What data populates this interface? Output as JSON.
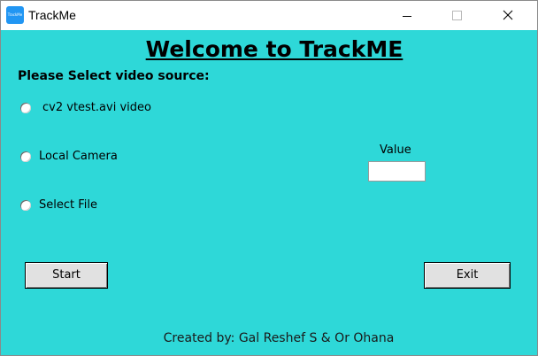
{
  "window": {
    "title": "TrackMe",
    "icon_text": "TrackMe"
  },
  "main": {
    "heading": "Welcome to TrackME",
    "prompt": "Please Select video source:",
    "sources": [
      {
        "label": "cv2 vtest.avi video",
        "selected": false
      },
      {
        "label": "Local Camera",
        "selected": false
      },
      {
        "label": "Select File",
        "selected": false
      }
    ],
    "value_label": "Value",
    "value_input": "",
    "start_button": "Start",
    "exit_button": "Exit",
    "credit": "Created by: Gal Reshef S & Or Ohana"
  },
  "colors": {
    "background": "#2ed8d8",
    "titlebar": "#ffffff",
    "button": "#e1e1e1"
  },
  "icons": [
    "app-icon",
    "minimize-icon",
    "maximize-icon",
    "close-icon"
  ]
}
